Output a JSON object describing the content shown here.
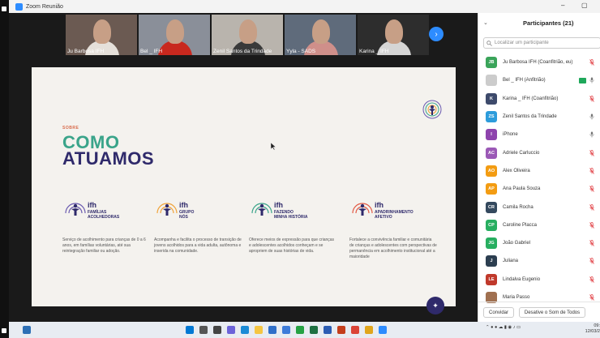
{
  "window": {
    "title": "Zoom Reunião",
    "minimize": "–",
    "maximize": "▢"
  },
  "thumbnails": [
    {
      "label": "Ju Barbosa IFH",
      "bg": "#6b5a52",
      "shirt": "#e5e0da"
    },
    {
      "label": "Bel _ IFH",
      "bg": "#8a8f99",
      "shirt": "#c8281e"
    },
    {
      "label": "Zenil Santos da Trindade",
      "bg": "#b9b4ad",
      "shirt": "#3a3a3a"
    },
    {
      "label": "Yyla - SADS",
      "bg": "#5f6b7b",
      "shirt": "#cf8f8a"
    },
    {
      "label": "Karina _ IFH",
      "bg": "#2d2d2d",
      "shirt": "#d5d5d5"
    }
  ],
  "next_button": "›",
  "slide": {
    "sobre": "SOBRE",
    "title_line1": "COMO",
    "title_line2": "ATUAMOS",
    "programs": [
      {
        "ifh": "ifh",
        "sub": [
          "FAMÍLIAS",
          "ACOLHEDORAS"
        ],
        "desc": "Serviço de acolhimento para crianças de 0 a 6 anos, em famílias voluntárias, até sua reintegração familiar ou adoção.",
        "color": "#6b5bb0"
      },
      {
        "ifh": "ifh",
        "sub": [
          "GRUPO",
          "NÓS"
        ],
        "desc": "Acompanha e facilita o processo de transição de jovens acolhidos para a vida adulta, autônoma e inserida na comunidade.",
        "color": "#f0a33a"
      },
      {
        "ifh": "ifh",
        "sub": [
          "FAZENDO",
          "MINHA HISTÓRIA"
        ],
        "desc": "Oferece meios de expressão para que crianças e adolescentes acolhidos conheçam e se apropriem de suas histórias de vida.",
        "color": "#3aa48a"
      },
      {
        "ifh": "ifh",
        "sub": [
          "APADRINHAMENTO",
          "AFETIVO"
        ],
        "desc": "Fortalece a convivência familiar e comunitária de crianças e adolescentes com perspectivas de permanência em acolhimento institucional até a maioridade",
        "color": "#e25a45"
      }
    ]
  },
  "participants": {
    "title": "Participantes (21)",
    "search_placeholder": "Localizar um participante",
    "list": [
      {
        "initials": "JB",
        "name": "Ju Barbosa IFH (Coanfitrião, eu)",
        "color": "#3aa45a",
        "muted": true
      },
      {
        "initials": "",
        "name": "Bel _ IFH (Anfitrião)",
        "color": "#cccccc",
        "muted": false,
        "video": true
      },
      {
        "initials": "K",
        "name": "Karina _ IFH (Coanfitrião)",
        "color": "#3d4a6b",
        "muted": true
      },
      {
        "initials": "ZS",
        "name": "Zenil Santos da Trindade",
        "color": "#2d9cdb",
        "muted": false
      },
      {
        "initials": "I",
        "name": "iPhone",
        "color": "#8e44ad",
        "muted": false
      },
      {
        "initials": "AC",
        "name": "Adriele Carluccio",
        "color": "#9b59b6",
        "muted": true
      },
      {
        "initials": "AO",
        "name": "Alex Oliveira",
        "color": "#f39c12",
        "muted": true
      },
      {
        "initials": "AP",
        "name": "Ana Paula Souza",
        "color": "#f39c12",
        "muted": true
      },
      {
        "initials": "CR",
        "name": "Camila Rocha",
        "color": "#34495e",
        "muted": true
      },
      {
        "initials": "CP",
        "name": "Caroline Placca",
        "color": "#27ae60",
        "muted": true
      },
      {
        "initials": "JG",
        "name": "João Gabriel",
        "color": "#27ae60",
        "muted": true
      },
      {
        "initials": "J",
        "name": "Juliana",
        "color": "#2c3e50",
        "muted": true
      },
      {
        "initials": "LE",
        "name": "Lindalva Eugenio",
        "color": "#c0392b",
        "muted": true
      },
      {
        "initials": "",
        "name": "Maria Passo",
        "color": "#a07050",
        "muted": true
      }
    ],
    "invite_button": "Convidar",
    "mute_all_button": "Desative o Som de Todos"
  },
  "taskbar": {
    "time": "09:",
    "date": "12/03/2"
  }
}
